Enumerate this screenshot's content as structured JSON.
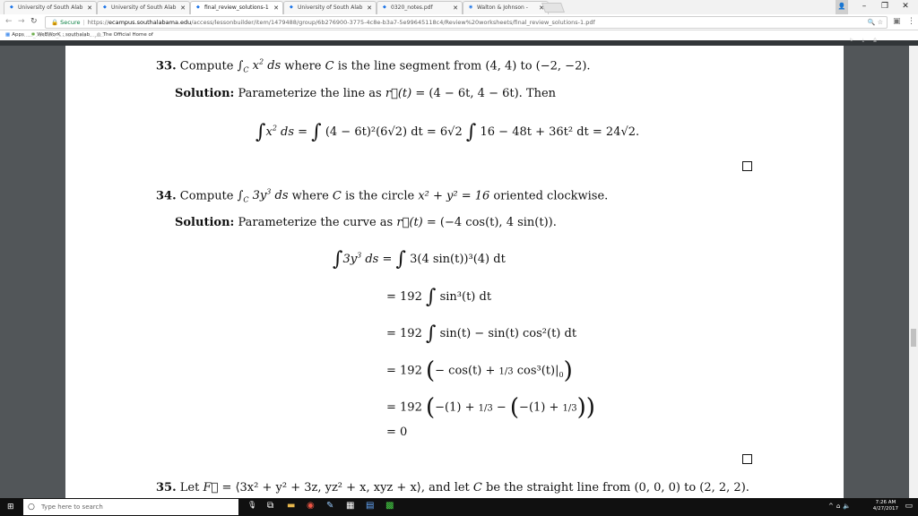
{
  "browser": {
    "tabs": [
      {
        "label": "University of South Alab",
        "active": false
      },
      {
        "label": "University of South Alab",
        "active": false
      },
      {
        "label": "final_review_solutions-1",
        "active": true
      },
      {
        "label": "University of South Alab",
        "active": false
      },
      {
        "label": "0320_notes.pdf",
        "active": false
      },
      {
        "label": "Walton & Johnson -",
        "active": false
      }
    ],
    "window_controls": {
      "minimize": "–",
      "maximize": "❐",
      "close": "✕"
    },
    "secure_label": "Secure",
    "url_scheme": "https://",
    "url_host": "ecampus.southalabama.edu",
    "url_path": "/access/lessonbuilder/item/1479488/group/6b276900-3775-4c8e-b3a7-5e99645118c4/Review%20worksheets/final_review_solutions-1.pdf",
    "bookmarks": [
      "Apps",
      "WeBWorK : southalab",
      "The Official Home of"
    ]
  },
  "pdf": {
    "title": "final_review_solutions-1.pdf"
  },
  "doc": {
    "p33": {
      "number": "33.",
      "question_prefix": "Compute",
      "question_mid": "where",
      "question_text": "is the line segment from",
      "from": "(4, 4)",
      "to_word": "to",
      "to": "(−2, −2).",
      "solution_label": "Solution:",
      "solution_text": "Parameterize the line as",
      "param": "(4 − 6t, 4 − 6t).",
      "then": "Then",
      "eq_integrand": "(4 − 6t)²(6√2) dt = 6√2",
      "eq_rhs": "16 − 48t + 36t² dt = 24√2."
    },
    "p34": {
      "number": "34.",
      "question_prefix": "Compute",
      "question_mid": "where",
      "question_text": "is the circle",
      "circle": "x² + y² = 16",
      "orientation": "oriented clockwise.",
      "solution_label": "Solution:",
      "solution_text": "Parameterize the curve as",
      "param": "(−4 cos(t), 4 sin(t)).",
      "steps": [
        "3(4 sin(t))³(4) dt",
        "= 192",
        "= 192",
        "= 192",
        "= 192",
        "= 0"
      ],
      "step2_integrand": "sin³(t) dt",
      "step3_integrand": "sin(t) − sin(t) cos²(t) dt",
      "step4_inner": "− cos(t) +",
      "step4_cos": "cos³(t)",
      "step5_inner": "−(1) +",
      "step5_inner2": "−(1) +"
    },
    "p35": {
      "number": "35.",
      "text_let": "Let",
      "field": "= ⟨3x² + y² + 3z, yz² + x, xyz + x⟩,",
      "text_rest": "and let",
      "line_desc": "be the straight line from (0, 0, 0) to (2, 2, 2)."
    }
  },
  "taskbar": {
    "search_placeholder": "Type here to search",
    "time": "7:26 AM",
    "date": "4/27/2017"
  }
}
